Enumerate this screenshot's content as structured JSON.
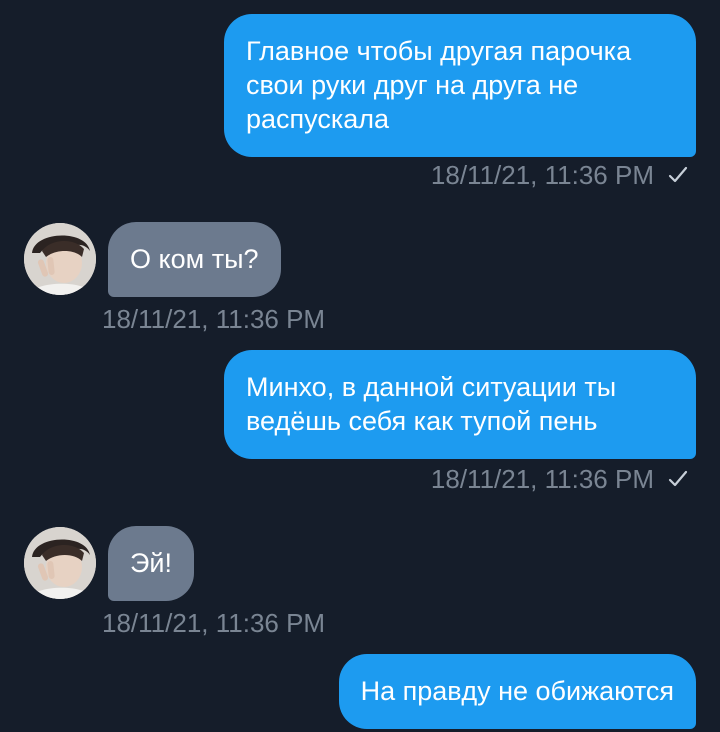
{
  "messages": [
    {
      "direction": "out",
      "text": "Главное чтобы другая парочка свои руки друг на друга не распускала",
      "timestamp": "18/11/21, 11:36 PM",
      "status": "sent"
    },
    {
      "direction": "in",
      "text": "О ком ты?",
      "timestamp": "18/11/21, 11:36 PM"
    },
    {
      "direction": "out",
      "text": "Минхо, в данной ситуации ты ведёшь себя как тупой пень",
      "timestamp": "18/11/21, 11:36 PM",
      "status": "sent"
    },
    {
      "direction": "in",
      "text": "Эй!",
      "timestamp": "18/11/21, 11:36 PM"
    },
    {
      "direction": "out",
      "text": "На правду не обижаются"
    }
  ],
  "colors": {
    "background": "#151d2a",
    "outgoing_bubble": "#1d9bf0",
    "incoming_bubble": "#6c7a8e",
    "meta_text": "#7a8593"
  },
  "icons": {
    "sent_status": "check-icon",
    "contact_avatar": "avatar"
  }
}
